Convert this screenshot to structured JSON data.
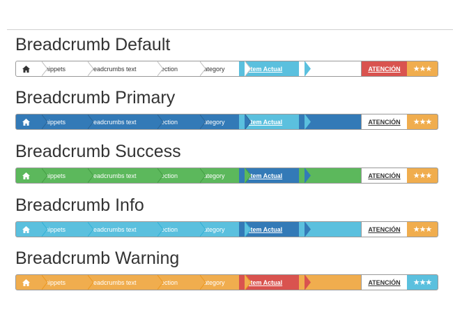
{
  "breadcrumbs": [
    {
      "title": "Breadcrumb Default",
      "items": [
        "Snippets",
        "Breadcrumbs text",
        "Section",
        "Category"
      ],
      "active": "Item Actual",
      "atencion": "ATENCIÓN",
      "stars": "★★★",
      "colors": {
        "bar": "#ffffff",
        "text": "#333333",
        "separator": "#bdbdbd",
        "active_bg": "#5bc0de",
        "active_text": "#ffffff",
        "home_color": "#333333",
        "atencion_bg": "#d9534f",
        "atencion_text": "#ffffff",
        "stars_bg": "#f0ad4e"
      }
    },
    {
      "title": "Breadcrumb Primary",
      "items": [
        "Snippets",
        "Breadcrumbs text",
        "Section",
        "Category"
      ],
      "active": "Item Actual",
      "atencion": "ATENCIÓN",
      "stars": "★★★",
      "colors": {
        "bar": "#337ab7",
        "text": "#ffffff",
        "separator": "#2a6496",
        "active_bg": "#5bc0de",
        "active_text": "#ffffff",
        "home_color": "#ffffff",
        "atencion_bg": "#ffffff",
        "atencion_text": "#333333",
        "stars_bg": "#f0ad4e"
      }
    },
    {
      "title": "Breadcrumb Success",
      "items": [
        "Snippets",
        "Breadcrumbs text",
        "Section",
        "Category"
      ],
      "active": "Item Actual",
      "atencion": "ATENCIÓN",
      "stars": "★★★",
      "colors": {
        "bar": "#5cb85c",
        "text": "#ffffff",
        "separator": "#449d44",
        "active_bg": "#337ab7",
        "active_text": "#ffffff",
        "home_color": "#ffffff",
        "atencion_bg": "#ffffff",
        "atencion_text": "#333333",
        "stars_bg": "#f0ad4e"
      }
    },
    {
      "title": "Breadcrumb Info",
      "items": [
        "Snippets",
        "Breadcrumbs text",
        "Section",
        "Category"
      ],
      "active": "Item Actual",
      "atencion": "ATENCIÓN",
      "stars": "★★★",
      "colors": {
        "bar": "#5bc0de",
        "text": "#ffffff",
        "separator": "#31b0d5",
        "active_bg": "#337ab7",
        "active_text": "#ffffff",
        "home_color": "#ffffff",
        "atencion_bg": "#ffffff",
        "atencion_text": "#333333",
        "stars_bg": "#f0ad4e"
      }
    },
    {
      "title": "Breadcrumb Warning",
      "items": [
        "Snippets",
        "Breadcrumbs text",
        "Section",
        "Category"
      ],
      "active": "Item Actual",
      "atencion": "ATENCIÓN",
      "stars": "★★★",
      "colors": {
        "bar": "#f0ad4e",
        "text": "#ffffff",
        "separator": "#ec971f",
        "active_bg": "#d9534f",
        "active_text": "#ffffff",
        "home_color": "#ffffff",
        "atencion_bg": "#ffffff",
        "atencion_text": "#333333",
        "stars_bg": "#5bc0de"
      }
    }
  ],
  "icons": {
    "home": "home-icon"
  }
}
